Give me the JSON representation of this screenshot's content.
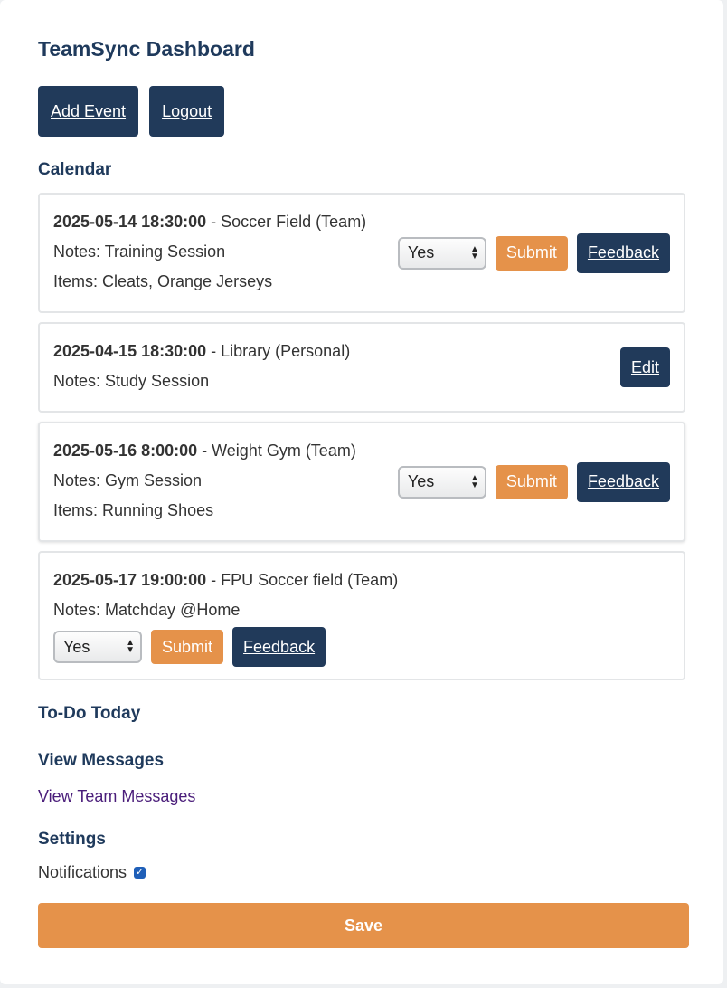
{
  "header": {
    "title": "TeamSync Dashboard",
    "add_event_label": "Add Event",
    "logout_label": "Logout"
  },
  "calendar": {
    "title": "Calendar",
    "events": [
      {
        "datetime": "2025-05-14 18:30:00",
        "location": " - Soccer Field (Team)",
        "notes": "Notes: Training Session",
        "items": "Items: Cleats, Orange Jerseys",
        "rsvp": "Yes",
        "submit_label": "Submit",
        "feedback_label": "Feedback"
      },
      {
        "datetime": "2025-04-15 18:30:00",
        "location": " - Library (Personal)",
        "notes": "Notes: Study Session",
        "edit_label": "Edit"
      },
      {
        "datetime": "2025-05-16 8:00:00",
        "location": " - Weight Gym (Team)",
        "notes": "Notes: Gym Session",
        "items": "Items: Running Shoes",
        "rsvp": "Yes",
        "submit_label": "Submit",
        "feedback_label": "Feedback"
      },
      {
        "datetime": "2025-05-17 19:00:00",
        "location": " - FPU Soccer field (Team)",
        "notes": "Notes: Matchday @Home",
        "rsvp": "Yes",
        "submit_label": "Submit",
        "feedback_label": "Feedback"
      }
    ]
  },
  "todo": {
    "title": "To-Do Today"
  },
  "messages": {
    "title": "View Messages",
    "link_label": "View Team Messages"
  },
  "settings": {
    "title": "Settings",
    "notifications_label": "Notifications",
    "notifications_checked": true,
    "save_label": "Save"
  },
  "colors": {
    "navy": "#213a5a",
    "orange": "#e5924a",
    "heading": "#1f3a5c",
    "link": "#4a1d7a"
  },
  "icons": {
    "select_arrows": "chevron-up-down-icon",
    "checkbox": "checkmark-icon"
  }
}
